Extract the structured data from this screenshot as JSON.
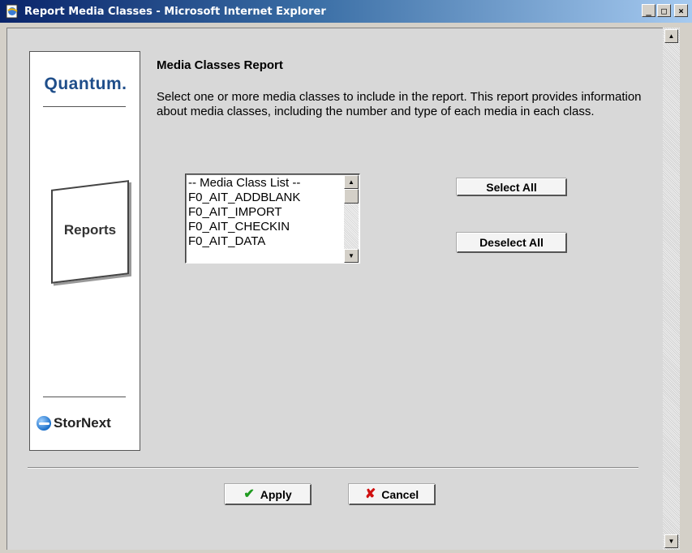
{
  "window": {
    "title": "Report Media Classes - Microsoft Internet Explorer",
    "controls": {
      "minimize": "_",
      "maximize": "□",
      "close": "×"
    }
  },
  "brand": {
    "logo_text": "Quantum.",
    "section_label": "Reports",
    "product_text": "StorNext"
  },
  "main": {
    "title": "Media Classes Report",
    "description": "Select one or more media classes to include in the report. This report provides information about media classes, including the number and type of each media in each class.",
    "media_class_list": [
      "-- Media Class List --",
      "F0_AIT_ADDBLANK",
      "F0_AIT_IMPORT",
      "F0_AIT_CHECKIN",
      "F0_AIT_DATA"
    ],
    "select_all_label": "Select All",
    "deselect_all_label": "Deselect All"
  },
  "footer": {
    "apply_label": "Apply",
    "cancel_label": "Cancel"
  },
  "colors": {
    "titlebar_start": "#0a246a",
    "brand_blue": "#1f4e8a",
    "apply_icon": "#1e9a1e",
    "cancel_icon": "#d01010"
  },
  "icons": {
    "app": "ie-page-icon",
    "apply": "checkmark-icon",
    "cancel": "x-icon",
    "product": "stornext-globe-icon"
  }
}
